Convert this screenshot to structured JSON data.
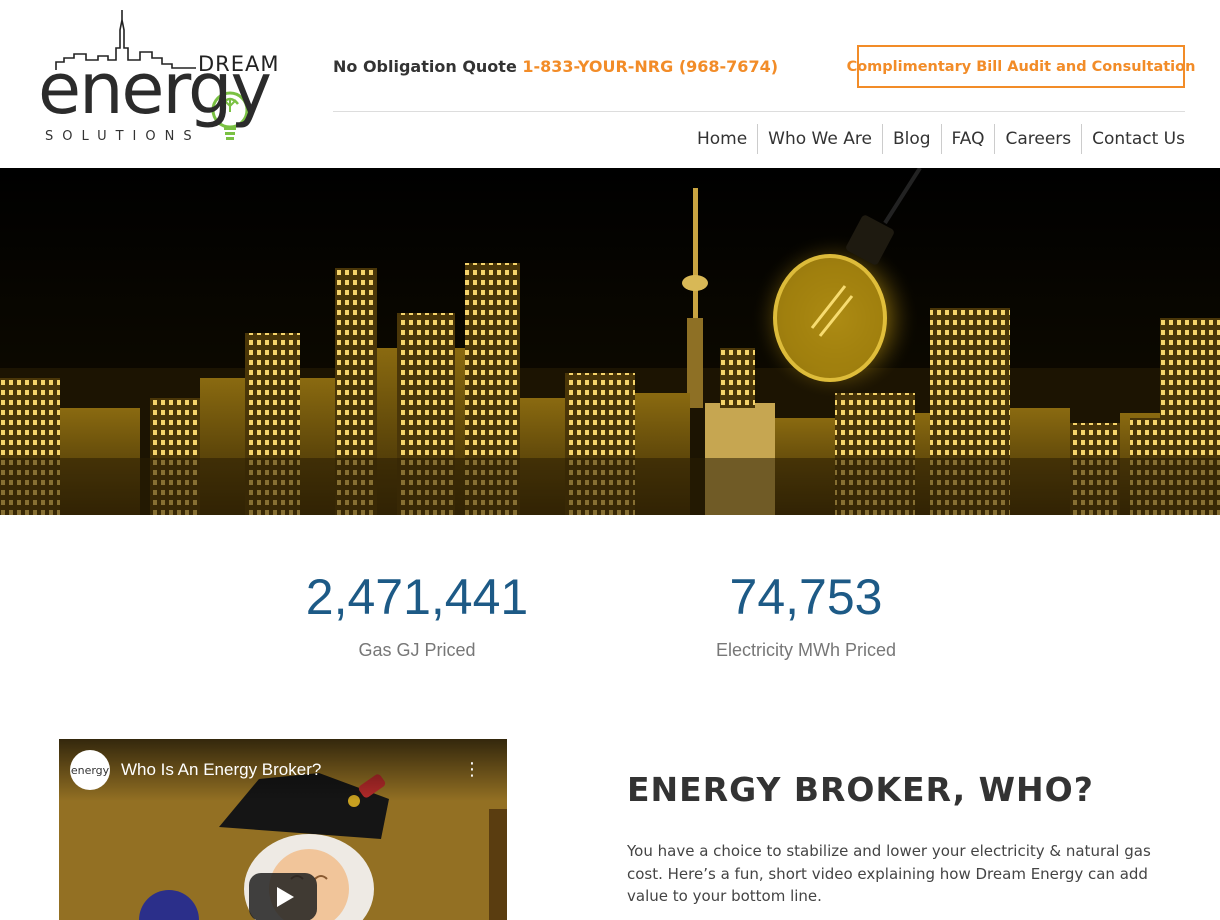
{
  "logo": {
    "dream": "DREAM",
    "energy": "energy",
    "solutions": "SOLUTIONS",
    "alt": "Dream Energy Solutions"
  },
  "header": {
    "quote_label": "No Obligation Quote",
    "quote_phone": "1-833-YOUR-NRG (968-7674)",
    "audit_button": "Complimentary Bill Audit and Consultation"
  },
  "nav": {
    "items": [
      {
        "label": "Home"
      },
      {
        "label": "Who We Are"
      },
      {
        "label": "Blog"
      },
      {
        "label": "FAQ"
      },
      {
        "label": "Careers"
      },
      {
        "label": "Contact Us"
      }
    ]
  },
  "stats": [
    {
      "value": "2,471,441",
      "label": "Gas GJ Priced"
    },
    {
      "value": "74,753",
      "label": "Electricity MWh Priced"
    }
  ],
  "video": {
    "channel_avatar": "energy",
    "title": "Who Is An Energy Broker?",
    "menu_icon": "more-vertical-icon",
    "play_icon": "play-icon"
  },
  "section": {
    "heading": "ENERGY BROKER, WHO?",
    "body": "You have a choice to stabilize and lower your electricity & natural gas cost. Here’s a fun, short video explaining how Dream Energy can add value to your bottom line."
  },
  "colors": {
    "accent_orange": "#f28c28",
    "stat_blue": "#1d5a86",
    "text_dark": "#333333",
    "logo_green": "#7ac143"
  }
}
